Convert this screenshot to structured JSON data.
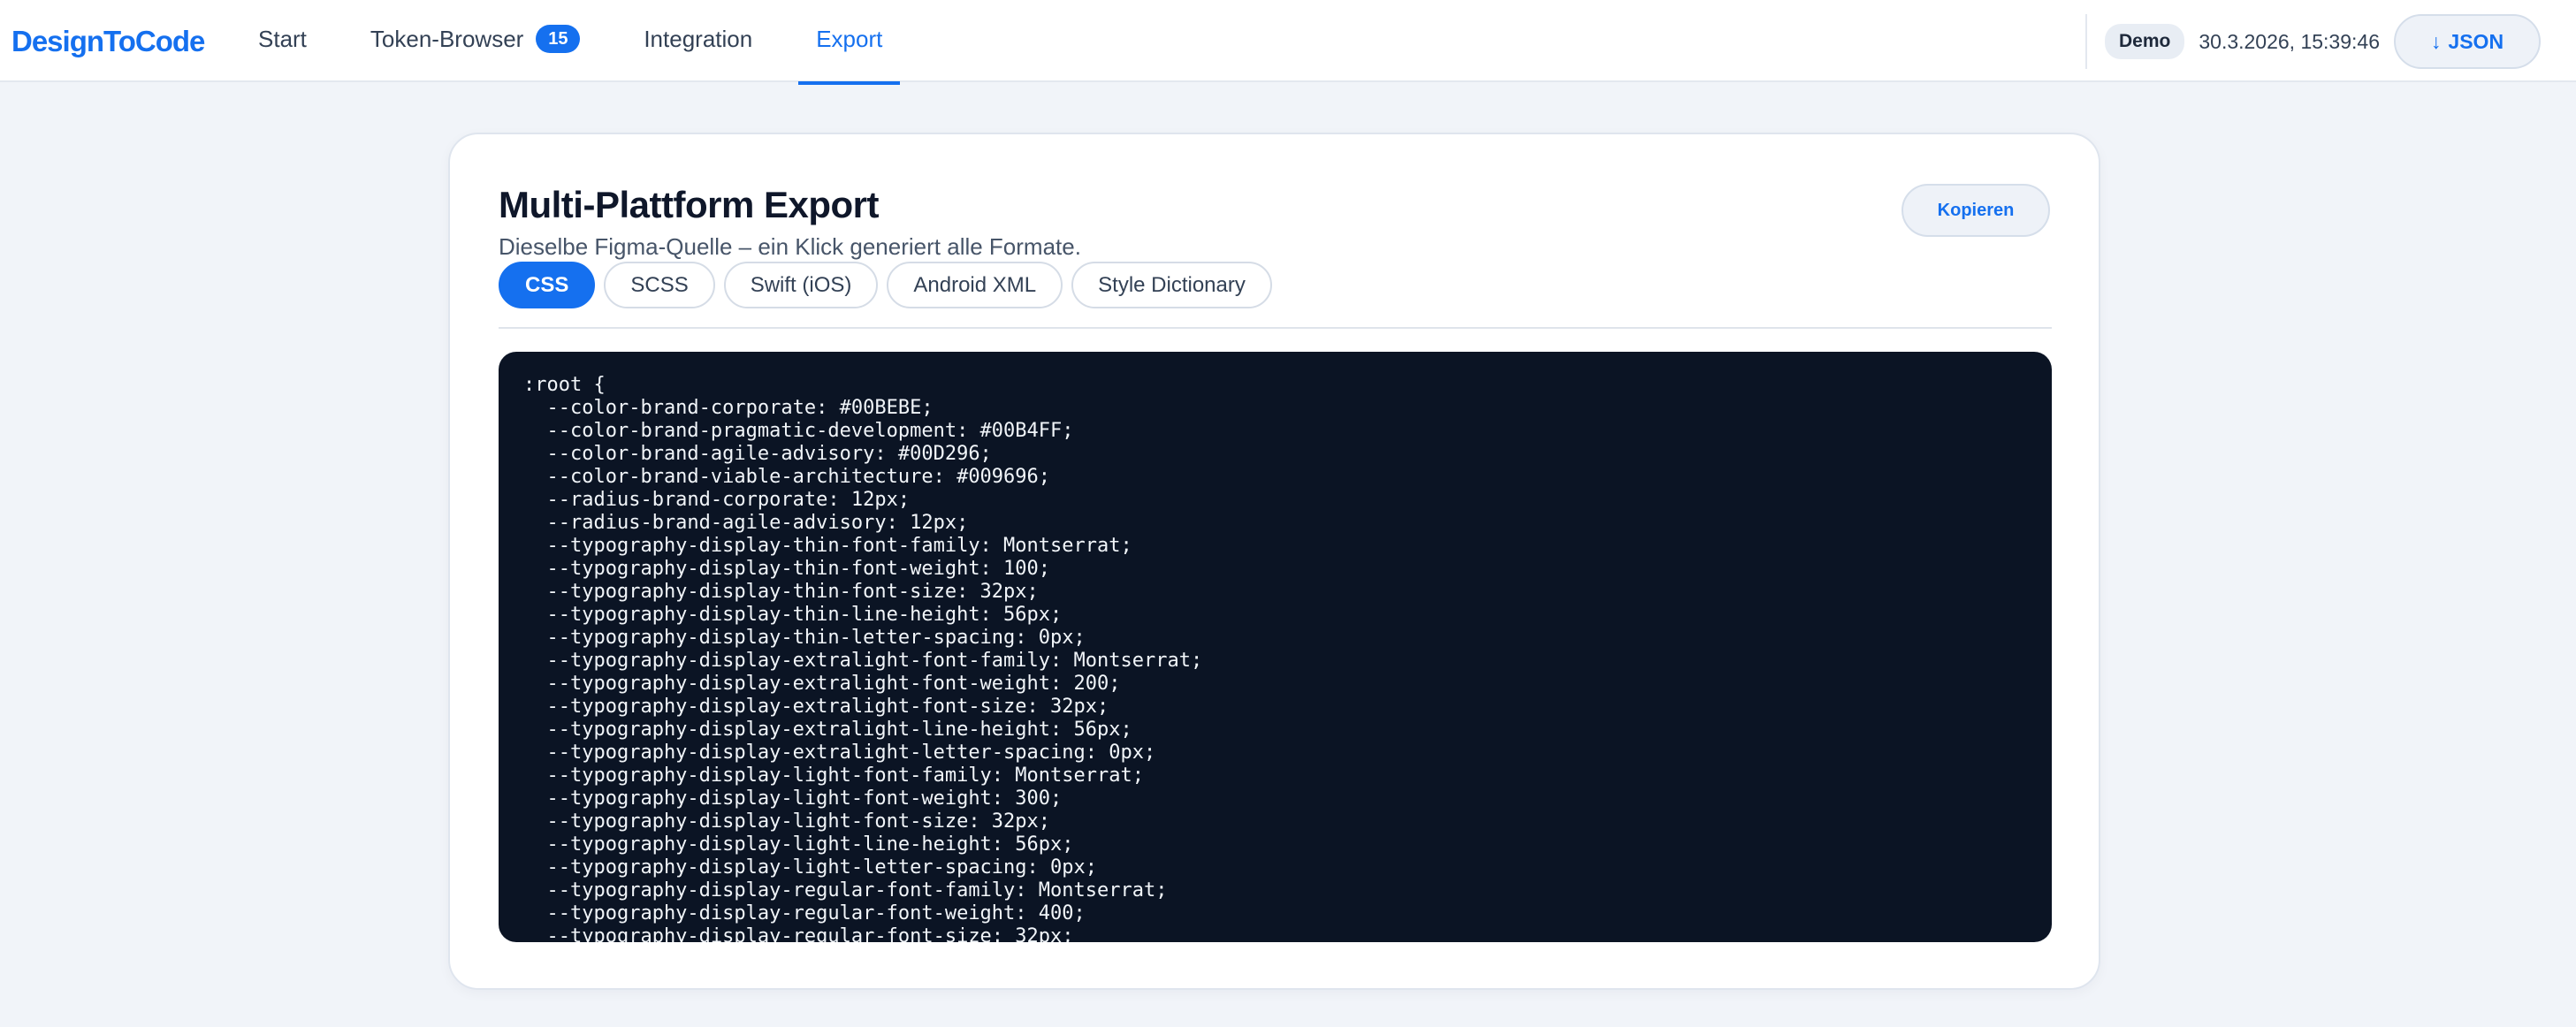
{
  "app": {
    "brand": "DesignToCode"
  },
  "nav": {
    "items": [
      {
        "label": "Start"
      },
      {
        "label": "Token-Browser",
        "badge": "15"
      },
      {
        "label": "Integration"
      },
      {
        "label": "Export",
        "active": true
      }
    ]
  },
  "header_right": {
    "demo_label": "Demo",
    "timestamp": "30.3.2026, 15:39:46",
    "json_button": "JSON",
    "json_icon": "↓"
  },
  "colors": {
    "accent": "#1570ef",
    "code_background": "#0b1424",
    "page_background": "#f1f4f9"
  },
  "export": {
    "title": "Multi-Plattform Export",
    "subtitle": "Dieselbe Figma-Quelle – ein Klick generiert alle Formate.",
    "copy_button": "Kopieren",
    "tabs": [
      {
        "label": "CSS",
        "active": true
      },
      {
        "label": "SCSS"
      },
      {
        "label": "Swift (iOS)"
      },
      {
        "label": "Android XML"
      },
      {
        "label": "Style Dictionary"
      }
    ],
    "code": ":root {\n  --color-brand-corporate: #00BEBE;\n  --color-brand-pragmatic-development: #00B4FF;\n  --color-brand-agile-advisory: #00D296;\n  --color-brand-viable-architecture: #009696;\n  --radius-brand-corporate: 12px;\n  --radius-brand-agile-advisory: 12px;\n  --typography-display-thin-font-family: Montserrat;\n  --typography-display-thin-font-weight: 100;\n  --typography-display-thin-font-size: 32px;\n  --typography-display-thin-line-height: 56px;\n  --typography-display-thin-letter-spacing: 0px;\n  --typography-display-extralight-font-family: Montserrat;\n  --typography-display-extralight-font-weight: 200;\n  --typography-display-extralight-font-size: 32px;\n  --typography-display-extralight-line-height: 56px;\n  --typography-display-extralight-letter-spacing: 0px;\n  --typography-display-light-font-family: Montserrat;\n  --typography-display-light-font-weight: 300;\n  --typography-display-light-font-size: 32px;\n  --typography-display-light-line-height: 56px;\n  --typography-display-light-letter-spacing: 0px;\n  --typography-display-regular-font-family: Montserrat;\n  --typography-display-regular-font-weight: 400;\n  --typography-display-regular-font-size: 32px;"
  }
}
